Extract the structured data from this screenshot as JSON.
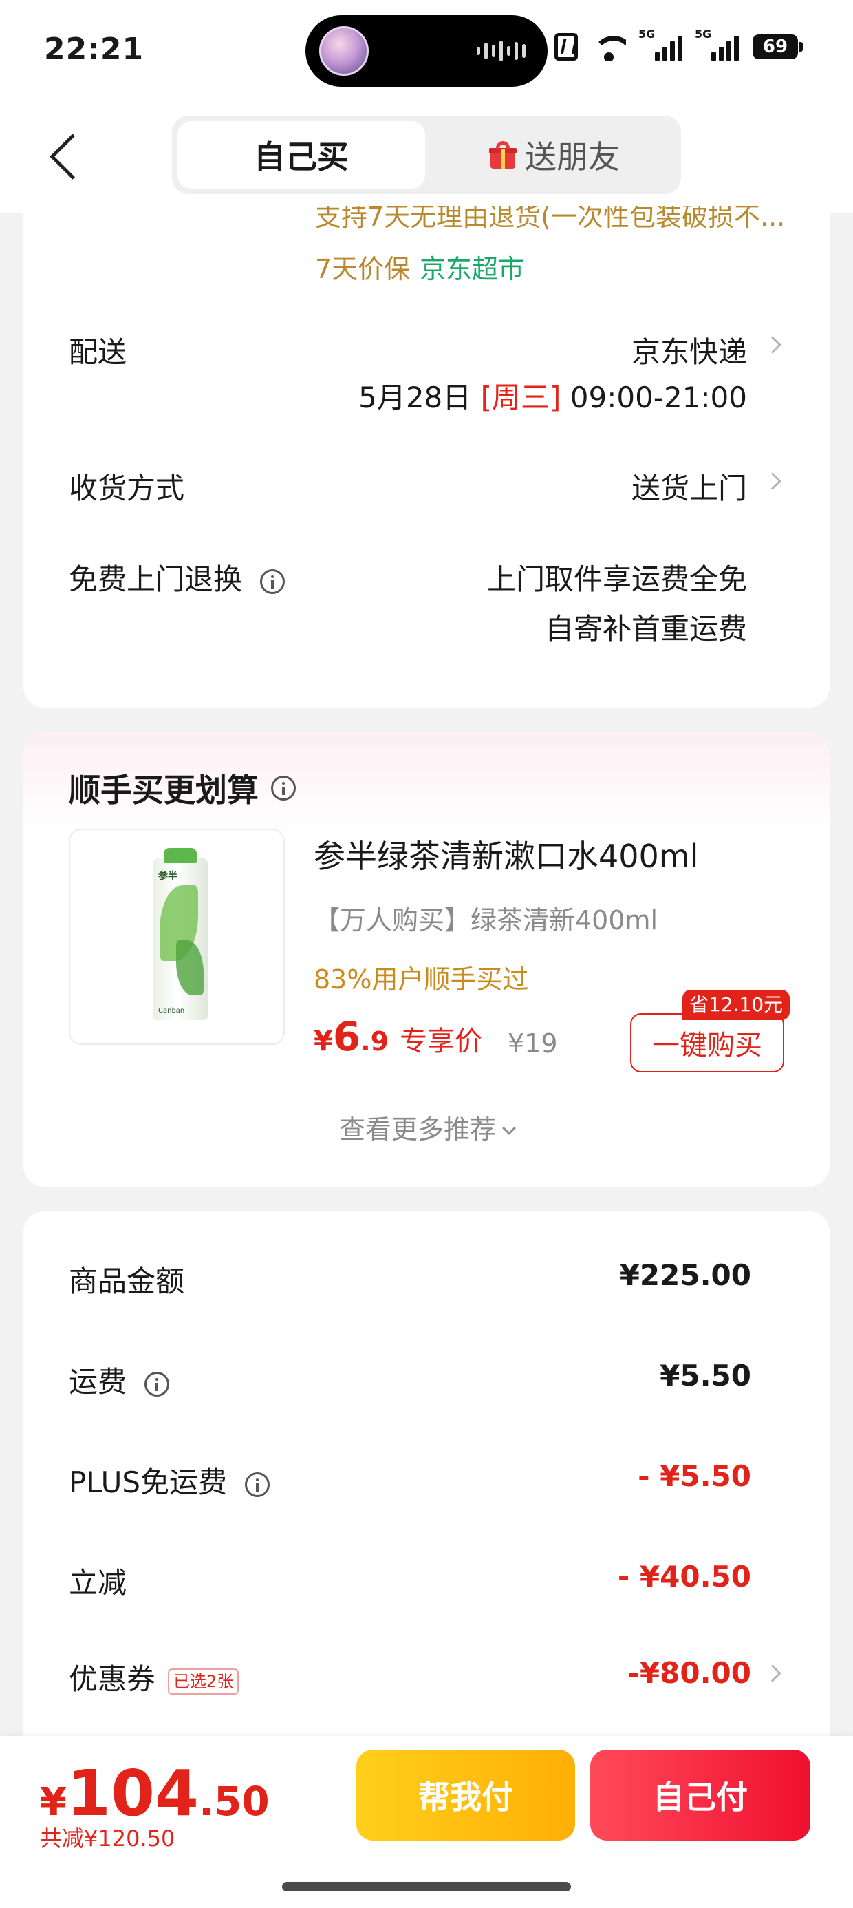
{
  "status_bar": {
    "time": "22:21",
    "net1": "5G",
    "net2": "5G",
    "battery": "69",
    "icons": [
      "nfc-icon",
      "wifi-icon",
      "signal-icon",
      "signal-icon",
      "battery-icon"
    ]
  },
  "header": {
    "tabs": [
      {
        "label": "自己买",
        "active": true
      },
      {
        "label": "送朋友",
        "icon": "gift-icon"
      }
    ]
  },
  "delivery": {
    "warranty_cut": "支持7天无理由退货(一次性包装破损不...",
    "warranty": "7天价保",
    "store": "京东超市",
    "shipping_label": "配送",
    "shipping_value": "京东快递",
    "date": "5月28日",
    "weekday": "[周三]",
    "time_range": "09:00-21:00",
    "receive_label": "收货方式",
    "receive_value": "送货上门",
    "return_label": "免费上门退换",
    "return_line1": "上门取件享运费全免",
    "return_line2": "自寄补首重运费"
  },
  "addon": {
    "title": "顺手买更划算",
    "product": {
      "name": "参半绿茶清新漱口水400ml",
      "subtitle": "【万人购买】绿茶清新400ml",
      "bought": "83%用户顺手买过",
      "price_symbol": "¥",
      "price_int": "6",
      "price_dec": ".9",
      "price_tag": "专享价",
      "original_price": "¥19",
      "save_badge": "省12.10元",
      "buy_label": "一键购买",
      "img_brand": "参半",
      "img_foot": "Canban"
    },
    "more": "查看更多推荐"
  },
  "summary": {
    "goods_label": "商品金额",
    "goods_value": "¥225.00",
    "freight_label": "运费",
    "freight_value": "¥5.50",
    "plus_label": "PLUS免运费",
    "plus_value": "- ¥5.50",
    "discount_label": "立减",
    "discount_value": "- ¥40.50",
    "coupon_label": "优惠券",
    "coupon_badge": "已选2张",
    "coupon_value": "-¥80.00"
  },
  "bottom": {
    "total_symbol": "¥",
    "total_int": "104",
    "total_dec": ".50",
    "saved": "共减¥120.50",
    "help_pay": "帮我付",
    "self_pay": "自己付"
  },
  "colors": {
    "accent_red": "#e2231a",
    "yellow": "#ffbf10",
    "green": "#1aa86a",
    "gold": "#b8892e"
  }
}
